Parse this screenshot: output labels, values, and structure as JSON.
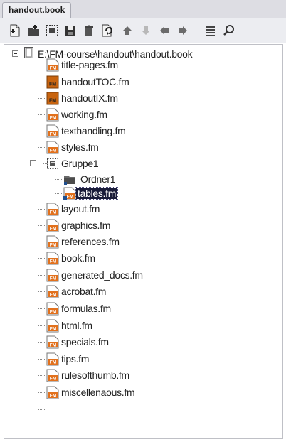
{
  "tab": {
    "title": "handout.book"
  },
  "toolbar": {
    "buttons": [
      {
        "icon": "add-file-icon"
      },
      {
        "icon": "add-folder-icon"
      },
      {
        "icon": "add-group-icon"
      },
      {
        "icon": "save-icon"
      },
      {
        "icon": "delete-icon"
      },
      {
        "icon": "update-book-icon"
      },
      {
        "icon": "move-up-icon"
      },
      {
        "icon": "move-down-icon"
      },
      {
        "icon": "move-left-icon"
      },
      {
        "icon": "move-right-icon"
      },
      {
        "icon": "list-icon"
      },
      {
        "icon": "search-icon"
      }
    ]
  },
  "tree": {
    "root": "E:\\FM-course\\handout\\handout.book",
    "items": [
      {
        "label": "title-pages.fm",
        "type": "fm"
      },
      {
        "label": "handoutTOC.fm",
        "type": "fm-generated"
      },
      {
        "label": "handoutIX.fm",
        "type": "fm-generated"
      },
      {
        "label": "working.fm",
        "type": "fm"
      },
      {
        "label": "texthandling.fm",
        "type": "fm"
      },
      {
        "label": "styles.fm",
        "type": "fm"
      },
      {
        "label": "Gruppe1",
        "type": "group"
      },
      {
        "label": "Ordner1",
        "type": "folder"
      },
      {
        "label": "tables.fm",
        "type": "fm-selected"
      },
      {
        "label": "layout.fm",
        "type": "fm"
      },
      {
        "label": "graphics.fm",
        "type": "fm"
      },
      {
        "label": "references.fm",
        "type": "fm"
      },
      {
        "label": "book.fm",
        "type": "fm"
      },
      {
        "label": "generated_docs.fm",
        "type": "fm"
      },
      {
        "label": "acrobat.fm",
        "type": "fm"
      },
      {
        "label": "formulas.fm",
        "type": "fm"
      },
      {
        "label": "html.fm",
        "type": "fm"
      },
      {
        "label": "specials.fm",
        "type": "fm"
      },
      {
        "label": "tips.fm",
        "type": "fm"
      },
      {
        "label": "rulesofthumb.fm",
        "type": "fm"
      },
      {
        "label": "miscellenaous.fm",
        "type": "fm"
      }
    ]
  },
  "colors": {
    "fm_orange": "#e2711d",
    "fm_generated": "#c8640f",
    "selection": "#1a1c3a"
  }
}
